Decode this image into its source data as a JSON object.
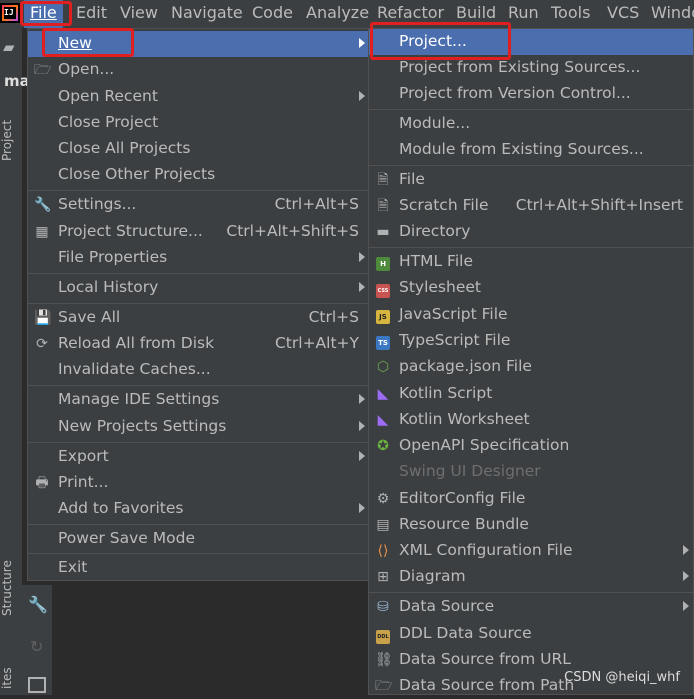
{
  "menubar": {
    "items": [
      "File",
      "Edit",
      "View",
      "Navigate",
      "Code",
      "Analyze",
      "Refactor",
      "Build",
      "Run",
      "Tools",
      "VCS",
      "Windo"
    ]
  },
  "toolstrip": {
    "top_label": "Project",
    "bottom_label": "Structure",
    "bottom2_label": "ites",
    "ma": "ma"
  },
  "file_menu": {
    "items": [
      {
        "label": "New",
        "shortcut": "",
        "arrow": true,
        "icon": ""
      },
      {
        "label": "Open...",
        "shortcut": "",
        "arrow": false,
        "icon": "folder-icon"
      },
      {
        "label": "Open Recent",
        "shortcut": "",
        "arrow": true,
        "icon": ""
      },
      {
        "label": "Close Project",
        "shortcut": "",
        "arrow": false,
        "icon": ""
      },
      {
        "label": "Close All Projects",
        "shortcut": "",
        "arrow": false,
        "icon": ""
      },
      {
        "label": "Close Other Projects",
        "shortcut": "",
        "arrow": false,
        "icon": ""
      },
      {
        "label": "Settings...",
        "shortcut": "Ctrl+Alt+S",
        "arrow": false,
        "icon": "wrench-icon"
      },
      {
        "label": "Project Structure...",
        "shortcut": "Ctrl+Alt+Shift+S",
        "arrow": false,
        "icon": "project-structure-icon"
      },
      {
        "label": "File Properties",
        "shortcut": "",
        "arrow": true,
        "icon": ""
      },
      {
        "label": "Local History",
        "shortcut": "",
        "arrow": true,
        "icon": ""
      },
      {
        "label": "Save All",
        "shortcut": "Ctrl+S",
        "arrow": false,
        "icon": "save-icon"
      },
      {
        "label": "Reload All from Disk",
        "shortcut": "Ctrl+Alt+Y",
        "arrow": false,
        "icon": "reload-icon"
      },
      {
        "label": "Invalidate Caches...",
        "shortcut": "",
        "arrow": false,
        "icon": ""
      },
      {
        "label": "Manage IDE Settings",
        "shortcut": "",
        "arrow": true,
        "icon": ""
      },
      {
        "label": "New Projects Settings",
        "shortcut": "",
        "arrow": true,
        "icon": ""
      },
      {
        "label": "Export",
        "shortcut": "",
        "arrow": true,
        "icon": ""
      },
      {
        "label": "Print...",
        "shortcut": "",
        "arrow": false,
        "icon": "print-icon"
      },
      {
        "label": "Add to Favorites",
        "shortcut": "",
        "arrow": true,
        "icon": ""
      },
      {
        "label": "Power Save Mode",
        "shortcut": "",
        "arrow": false,
        "icon": ""
      },
      {
        "label": "Exit",
        "shortcut": "",
        "arrow": false,
        "icon": ""
      }
    ]
  },
  "new_submenu": {
    "items": [
      {
        "label": "Project...",
        "shortcut": "",
        "arrow": false
      },
      {
        "label": "Project from Existing Sources...",
        "shortcut": "",
        "arrow": false
      },
      {
        "label": "Project from Version Control...",
        "shortcut": "",
        "arrow": false
      },
      {
        "label": "Module...",
        "shortcut": "",
        "arrow": false
      },
      {
        "label": "Module from Existing Sources...",
        "shortcut": "",
        "arrow": false
      },
      {
        "label": "File",
        "shortcut": "",
        "arrow": false
      },
      {
        "label": "Scratch File",
        "shortcut": "Ctrl+Alt+Shift+Insert",
        "arrow": false
      },
      {
        "label": "Directory",
        "shortcut": "",
        "arrow": false
      },
      {
        "label": "HTML File",
        "shortcut": "",
        "arrow": false
      },
      {
        "label": "Stylesheet",
        "shortcut": "",
        "arrow": false
      },
      {
        "label": "JavaScript File",
        "shortcut": "",
        "arrow": false
      },
      {
        "label": "TypeScript File",
        "shortcut": "",
        "arrow": false
      },
      {
        "label": "package.json File",
        "shortcut": "",
        "arrow": false
      },
      {
        "label": "Kotlin Script",
        "shortcut": "",
        "arrow": false
      },
      {
        "label": "Kotlin Worksheet",
        "shortcut": "",
        "arrow": false
      },
      {
        "label": "OpenAPI Specification",
        "shortcut": "",
        "arrow": false
      },
      {
        "label": "Swing UI Designer",
        "shortcut": "",
        "arrow": true
      },
      {
        "label": "EditorConfig File",
        "shortcut": "",
        "arrow": false
      },
      {
        "label": "Resource Bundle",
        "shortcut": "",
        "arrow": false
      },
      {
        "label": "XML Configuration File",
        "shortcut": "",
        "arrow": true
      },
      {
        "label": "Diagram",
        "shortcut": "",
        "arrow": true
      },
      {
        "label": "Data Source",
        "shortcut": "",
        "arrow": true
      },
      {
        "label": "DDL Data Source",
        "shortcut": "",
        "arrow": false
      },
      {
        "label": "Data Source from URL",
        "shortcut": "",
        "arrow": false
      },
      {
        "label": "Data Source from Path",
        "shortcut": "",
        "arrow": false
      }
    ],
    "icon_badges": {
      "html": "H",
      "css": "CSS",
      "js": "JS",
      "ts": "TS",
      "ddl": "DDL"
    }
  },
  "watermark": "CSDN @heiqi_whf",
  "colors": {
    "accent": "#4b6eaf",
    "menu_bg": "#3c3f41",
    "highlight_box": "#e02020"
  }
}
